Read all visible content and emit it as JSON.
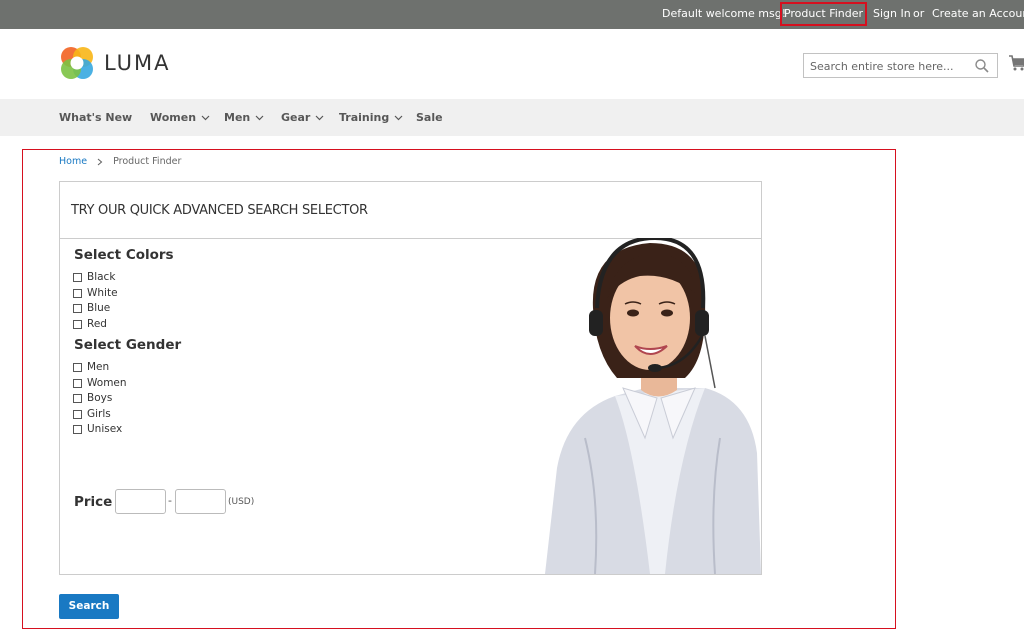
{
  "topbar": {
    "welcome": "Default welcome msg!",
    "product_finder": "Product Finder",
    "sign_in": "Sign In",
    "or": "or",
    "create_account": "Create an Account"
  },
  "header": {
    "logo_text": "LUMA",
    "search_placeholder": "Search entire store here..."
  },
  "nav": {
    "items": [
      {
        "label": "What's New",
        "has_dropdown": false
      },
      {
        "label": "Women",
        "has_dropdown": true
      },
      {
        "label": "Men",
        "has_dropdown": true
      },
      {
        "label": "Gear",
        "has_dropdown": true
      },
      {
        "label": "Training",
        "has_dropdown": true
      },
      {
        "label": "Sale",
        "has_dropdown": false
      }
    ]
  },
  "breadcrumb": {
    "home": "Home",
    "current": "Product Finder"
  },
  "finder": {
    "title": "TRY OUR QUICK ADVANCED SEARCH SELECTOR",
    "colors_title": "Select Colors",
    "colors": [
      "Black",
      "White",
      "Blue",
      "Red"
    ],
    "gender_title": "Select Gender",
    "genders": [
      "Men",
      "Women",
      "Boys",
      "Girls",
      "Unisex"
    ],
    "price_label": "Price",
    "price_separator": "-",
    "currency": "(USD)",
    "search_button": "Search"
  },
  "colors": {
    "topbar_bg": "#6e716e",
    "highlight": "#d6101f",
    "link": "#1979c3",
    "button": "#1979c3",
    "nav_bg": "#f0f0f0"
  }
}
